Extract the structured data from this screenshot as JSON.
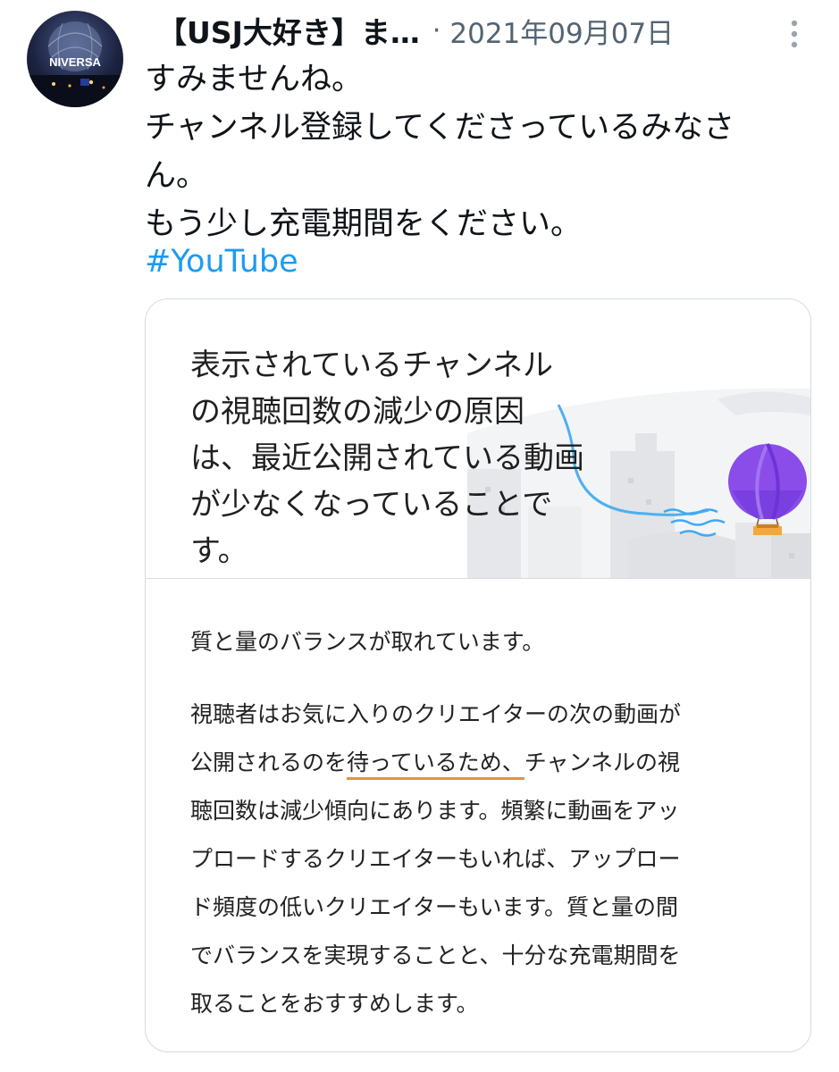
{
  "tweet": {
    "author_name": "【USJ大好き】ま…",
    "separator": "·",
    "timestamp": "2021年09月07日",
    "avatar_text": "NIVERSA",
    "text_lines": [
      "すみませんね。",
      "チャンネル登録してくださっているみなさ",
      "ん。",
      "もう少し充電期間をください。"
    ],
    "hashtag": "#YouTube"
  },
  "card": {
    "headline_lines": [
      "表示されているチャンネル",
      "の視聴回数の減少の原因",
      "は、最近公開されている動画",
      "が少なくなっていることで",
      "す。"
    ],
    "subheading": "質と量のバランスが取れています。",
    "body": {
      "line1": "視聴者はお気に入りのクリエイターの次の動画が",
      "line2_before": "公開されるのを",
      "line2_highlight": "待っているため、",
      "line2_after": "チャンネルの視",
      "line3": "聴回数は減少傾向にあります。頻繁に動画をアッ",
      "line4": "プロードするクリエイターもいれば、アップロー",
      "line5": "ド頻度の低いクリエイターもいます。質と量の間",
      "line6": "でバランスを実現することと、十分な充電期間を",
      "line7": "取ることをおすすめします。"
    }
  },
  "colors": {
    "hashtag": "#1d9bf0",
    "secondary_text": "#536471",
    "highlight_underline": "#e8913a",
    "balloon": "#8a4dea",
    "wind_lines": "#3fa9f5"
  },
  "icons": [
    "more-options-icon",
    "hot-air-balloon-icon"
  ]
}
